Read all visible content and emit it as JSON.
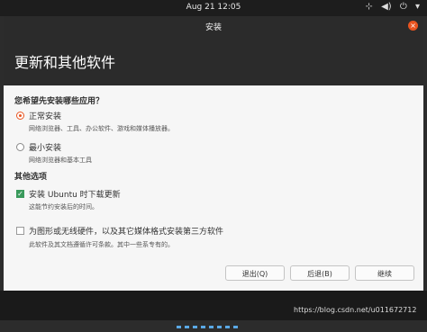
{
  "topbar": {
    "clock": "Aug 21  12:05",
    "icons": [
      "network-icon",
      "volume-icon",
      "power-icon",
      "chevron-down-icon"
    ]
  },
  "window": {
    "title": "安装",
    "close_glyph": "×"
  },
  "header": {
    "title": "更新和其他软件"
  },
  "question": "您希望先安装哪些应用？",
  "install_type": {
    "normal": {
      "label": "正常安装",
      "desc": "网络浏览器、工具、办公软件、游戏和媒体播放器。",
      "selected": true
    },
    "minimal": {
      "label": "最小安装",
      "desc": "网络浏览器和基本工具",
      "selected": false
    }
  },
  "other_options": {
    "heading": "其他选项",
    "download_updates": {
      "label": "安装 Ubuntu 时下载更新",
      "desc": "这能节约安装后的时间。",
      "checked": true
    },
    "third_party": {
      "label": "为图形或无线硬件，以及其它媒体格式安装第三方软件",
      "desc": "此软件及其文档遵循许可条款。其中一些系专有的。",
      "checked": false
    }
  },
  "buttons": {
    "quit": "退出(Q)",
    "back": "后退(B)",
    "continue": "继续"
  },
  "watermark": "https://blog.csdn.net/u011672712",
  "colors": {
    "accent": "#e95420",
    "check": "#3a9a5c",
    "header_bg": "#2b2b2b"
  }
}
